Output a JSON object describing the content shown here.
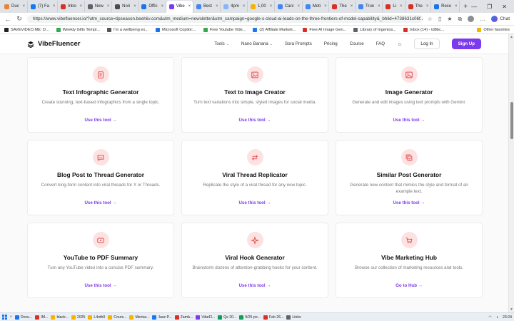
{
  "browser": {
    "tabs": [
      {
        "label": "Duc",
        "color": "#e8833a"
      },
      {
        "label": "(7) Fa",
        "color": "#1877f2"
      },
      {
        "label": "Inbo",
        "color": "#d93025"
      },
      {
        "label": "New",
        "color": "#5f6368"
      },
      {
        "label": "Nori",
        "color": "#4a4a4a"
      },
      {
        "label": "Offic",
        "color": "#1a73e8"
      },
      {
        "label": "Vibe",
        "color": "#7c3aed",
        "active": true
      },
      {
        "label": "Best",
        "color": "#4285f4"
      },
      {
        "label": "4pm",
        "color": "#8ab4f8"
      },
      {
        "label": "1,00",
        "color": "#f4b400"
      },
      {
        "label": "Carc",
        "color": "#4285f4"
      },
      {
        "label": "Moti",
        "color": "#4285f4"
      },
      {
        "label": "The",
        "color": "#d93025"
      },
      {
        "label": "Trun",
        "color": "#4285f4"
      },
      {
        "label": "Li",
        "color": "#d93025"
      },
      {
        "label": "The",
        "color": "#d93025"
      },
      {
        "label": "Reco",
        "color": "#1a73e8"
      }
    ],
    "new_tab": "+",
    "window_controls": [
      "—",
      "❐",
      "✕"
    ],
    "url": "https://www.vibefluencer.io/?utm_source=tipseason.beehiiv.com&utm_medium=newsletter&utm_campaign=google-s-cloud-ai-leads-on-the-three-frontiers-of-model-capability&_bhlid=4738631c06f...",
    "chat_label": "Chat",
    "bookmarks": [
      {
        "label": "SAVEVIDEO.ME: D...",
        "color": "#222222"
      },
      {
        "label": "Weekly Gifts Templ...",
        "color": "#34a853"
      },
      {
        "label": "I'm a wellbeing ex...",
        "color": "#555555"
      },
      {
        "label": "Microsoft Copilot:...",
        "color": "#1a73e8"
      },
      {
        "label": "Free Youtube Vide...",
        "color": "#34a853"
      },
      {
        "label": "(2) Affiliate Marketi...",
        "color": "#1877f2"
      },
      {
        "label": "Free AI Image Gen...",
        "color": "#d93025"
      },
      {
        "label": "Library of Ingenios...",
        "color": "#5f6368"
      },
      {
        "label": "Inbox (14) - td8bc...",
        "color": "#d93025"
      }
    ],
    "other_favorites": "Other favorites"
  },
  "site": {
    "brand": "VibeFluencer",
    "nav": [
      {
        "label": "Tools",
        "dropdown": true
      },
      {
        "label": "Nano Banana",
        "dropdown": true
      },
      {
        "label": "Sora Prompts",
        "dropdown": false
      },
      {
        "label": "Pricing",
        "dropdown": false
      },
      {
        "label": "Course",
        "dropdown": false
      },
      {
        "label": "FAQ",
        "dropdown": false
      }
    ],
    "login": "Log In",
    "signup": "Sign Up"
  },
  "cards": [
    {
      "title": "Text Infographic Generator",
      "desc": "Create stunning, text-based infographics from a single topic.",
      "link": "Use this tool →",
      "icon": "document-icon"
    },
    {
      "title": "Text to Image Creator",
      "desc": "Turn text variations into simple, styled images for social media.",
      "link": "Use this tool →",
      "icon": "image-edit-icon"
    },
    {
      "title": "Image Generator",
      "desc": "Generate and edit images using text prompts with Gemini.",
      "link": "Use this tool →",
      "icon": "image-icon"
    },
    {
      "title": "Blog Post to Thread Generator",
      "desc": "Convert long-form content into viral threads for X or Threads.",
      "link": "Use this tool →",
      "icon": "message-icon"
    },
    {
      "title": "Viral Thread Replicator",
      "desc": "Replicate the style of a viral thread for any new topic.",
      "link": "Use this tool →",
      "icon": "swap-icon"
    },
    {
      "title": "Similar Post Generator",
      "desc": "Generate new content that mimics the style and format of an example text.",
      "link": "Use this tool →",
      "icon": "copy-icon"
    },
    {
      "title": "YouTube to PDF Summary",
      "desc": "Turn any YouTube video into a concise PDF summary.",
      "link": "Use this tool →",
      "icon": "play-icon"
    },
    {
      "title": "Viral Hook Generator",
      "desc": "Brainstorm dozens of attention-grabbing hooks for your content.",
      "link": "Use this tool →",
      "icon": "sparkle-icon"
    },
    {
      "title": "Vibe Marketing Hub",
      "desc": "Browse our collection of marketing resources and tools.",
      "link": "Go to Hub →",
      "icon": "cart-icon"
    }
  ],
  "colors": {
    "accent": "#7c3aed",
    "icon_bg": "#fde2e2",
    "icon_stroke": "#e5484d"
  },
  "taskbar": {
    "apps": [
      {
        "label": "Docu...",
        "color": "#1a73e8"
      },
      {
        "label": "IM...",
        "color": "#d93025"
      },
      {
        "label": "black...",
        "color": "#f4b400"
      },
      {
        "label": "2025",
        "color": "#f4b400"
      },
      {
        "label": "L4nth0",
        "color": "#f4b400"
      },
      {
        "label": "Cours...",
        "color": "#f4b400"
      },
      {
        "label": "Merisa...",
        "color": "#f4b400"
      },
      {
        "label": "Jasz P...",
        "color": "#1877f2"
      },
      {
        "label": "Zamb...",
        "color": "#d93025"
      },
      {
        "label": "VibeFl...",
        "color": "#7c3aed"
      },
      {
        "label": "Qs 20...",
        "color": "#0f9d58"
      },
      {
        "label": "9/25 po...",
        "color": "#0f9d58"
      },
      {
        "label": "Feb 26...",
        "color": "#d93025"
      },
      {
        "label": "Links",
        "color": "#5f6368"
      }
    ],
    "time": "23:24"
  }
}
